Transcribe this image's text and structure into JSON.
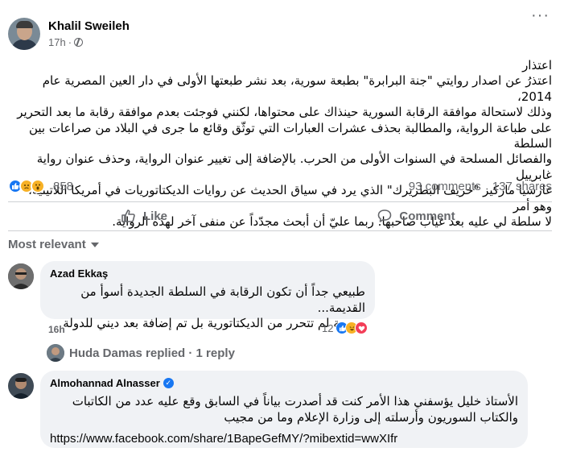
{
  "post": {
    "author": "Khalil Sweileh",
    "time": "17h",
    "privacy_icon": "globe-icon",
    "more_icon": "more-options-icon",
    "body_lines": [
      "اعتذار",
      "اعتذرُ عن اصدار روايتي \"جنة البرابرة\" بطبعة سورية، بعد نشر طبعتها الأولى في دار العين المصرية عام 2014،",
      "وذلك لاستحالة موافقة الرقابة السورية حينذاك على محتواها، لكنني فوجئت بعدم موافقة رقابة ما بعد التحرير",
      "على طباعة الرواية، والمطالبة بحذف عشرات العبارات التي توثّق وقائع ما جرى في البلاد من صراعات بين السلطة",
      "والفصائل المسلحة في السنوات الأولى من الحرب. بالإضافة إلى تغيير عنوان الرواية، وحذف عنوان رواية غابرييل",
      "غارسيا ماركيز \"خريف البطريرك\" الذي يرد في سياق الحديث عن روايات الديكتاتوريات في أمريكا اللاتينية، وهو أمر",
      "لا سلطة لي عليه بعد غياب صاحبها. ربما عليّ أن أبحث مجدّداً عن منفى آخر لهذه الرواية."
    ],
    "reaction_count": "858",
    "reaction_icons": [
      "like-icon",
      "sad-icon",
      "wow-icon"
    ],
    "comments_count": "93 comments",
    "shares_count": "137 shares"
  },
  "actions": {
    "like_label": "Like",
    "comment_label": "Comment"
  },
  "comments": {
    "sort_label": "Most relevant",
    "items": [
      {
        "author": "Azad Ekkaş",
        "lines": [
          "طبيعي جداً أن تكون الرقابة في السلطة الجديدة أسوأ من القديمة...",
          "سورية لم تتحرر من الديكتاتورية بل تم إضافة بعد ديني للدولة"
        ],
        "time": "16h",
        "reaction_count": "12"
      },
      {
        "author": "Almohannad Alnasser",
        "verified": true,
        "lines": [
          "الأستاذ خليل يؤسفني هذا الأمر كنت قد أصدرت بياناً في السابق وقع عليه عدد من الكاتبات",
          "والكتاب السوريون وأرسلته إلى وزارة الإعلام وما من مجيب"
        ],
        "link": "https://www.facebook.com/share/1BapeGefMY/?mibextid=wwXIfr"
      }
    ],
    "reply": {
      "text": "Huda Damas replied · 1 reply"
    }
  }
}
